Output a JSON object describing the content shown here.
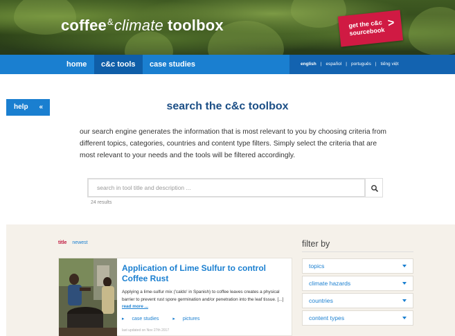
{
  "header": {
    "logo": {
      "part1": "coffee",
      "amp": "&",
      "part2": "climate",
      "part3": "toolbox"
    },
    "sourcebook_button": {
      "line1": "get the c&c",
      "line2": "sourcebook",
      "chevron": ">"
    }
  },
  "nav": {
    "items": [
      {
        "label": "home"
      },
      {
        "label": "c&c tools",
        "active": true
      },
      {
        "label": "case studies"
      }
    ],
    "languages": [
      {
        "label": "english",
        "active": true
      },
      {
        "label": "español"
      },
      {
        "label": "português"
      },
      {
        "label": "tiếng việt"
      }
    ],
    "separator": "|"
  },
  "help": {
    "label": "help",
    "icon": "«"
  },
  "main": {
    "title": "search the c&c toolbox",
    "intro": "our search engine generates the information that is most relevant to you by choosing criteria from different topics, categories, countries and content type filters. Simply select the criteria that are most relevant to your needs and the tools will be filtered accordingly.",
    "search": {
      "placeholder": "search in tool title and description ...",
      "value": ""
    },
    "result_count": "24 results"
  },
  "results": {
    "sort": {
      "title": "title",
      "newest": "newest"
    },
    "items": [
      {
        "title": "Application of Lime Sulfur to control Coffee Rust",
        "description": "Applying a lime-sulfur mix ('caldo' in Spanish) to coffee leaves creates a physical barrier to prevent rust spore germination and/or penetration into the leaf tissue. [...] ",
        "read_more": "read more ...",
        "tags": [
          "case studies",
          "pictures"
        ],
        "tag_marker": "▸",
        "updated": "last updated on Nov 27th 2017"
      }
    ]
  },
  "filters": {
    "title": "filter by",
    "items": [
      "topics",
      "climate hazards",
      "countries",
      "content types"
    ]
  },
  "colors": {
    "primary": "#1a7fd0",
    "nav_dark": "#0f5ea8",
    "accent_red": "#d01a43",
    "title_blue": "#1c4f86"
  }
}
